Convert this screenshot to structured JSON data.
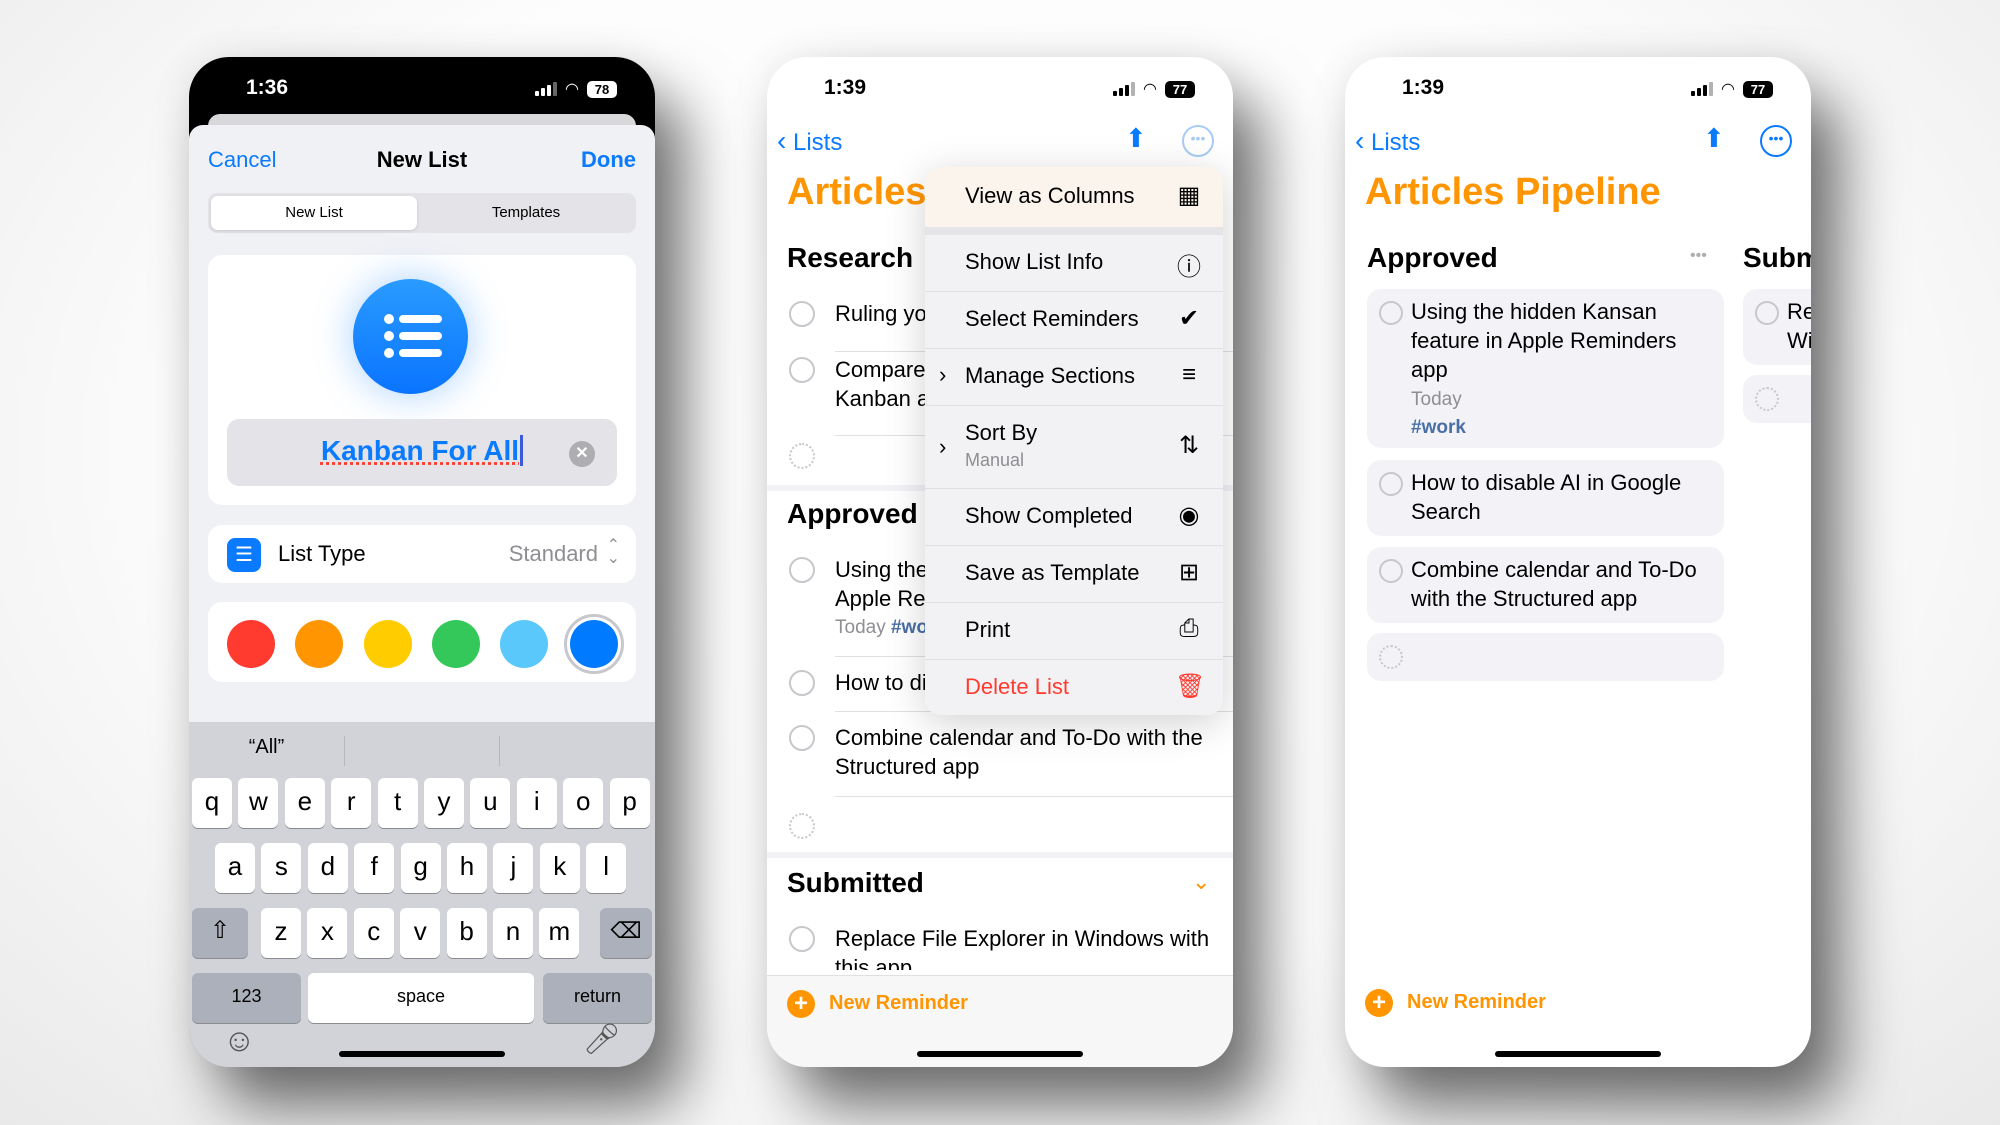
{
  "phones": [
    {
      "status": {
        "time": "1:36",
        "battery": "78"
      },
      "nav": {
        "cancel": "Cancel",
        "title": "New List",
        "done": "Done"
      },
      "segmented": {
        "options": [
          "New List",
          "Templates"
        ],
        "selected": "New List"
      },
      "icon": "list-bullet-icon",
      "name_field": {
        "value": "Kanban For All",
        "clear_icon": "clear-icon"
      },
      "list_type": {
        "label": "List Type",
        "value": "Standard",
        "icon": "list-bullet-icon"
      },
      "colors": [
        "#ff3b30",
        "#ff9500",
        "#ffcc00",
        "#34c759",
        "#5ac8fa",
        "#007aff"
      ],
      "selected_color": "#007aff",
      "keyboard": {
        "suggestions": [
          "“All”",
          "",
          ""
        ],
        "row1": [
          "q",
          "w",
          "e",
          "r",
          "t",
          "y",
          "u",
          "i",
          "o",
          "p"
        ],
        "row2": [
          "a",
          "s",
          "d",
          "f",
          "g",
          "h",
          "j",
          "k",
          "l"
        ],
        "row3": [
          "z",
          "x",
          "c",
          "v",
          "b",
          "n",
          "m"
        ],
        "numbers": "123",
        "space": "space",
        "return": "return"
      }
    },
    {
      "status": {
        "time": "1:39",
        "battery": "77"
      },
      "back": "Lists",
      "title": "Articles",
      "sections": [
        {
          "name": "Research",
          "items": [
            {
              "text": "Ruling yo"
            },
            {
              "text": "Compare",
              "text2": "Kanban a"
            }
          ]
        },
        {
          "name": "Approved",
          "items": [
            {
              "text": "Using the",
              "text2": "Apple Re",
              "meta_date": "Today",
              "meta_tag": "#wo"
            },
            {
              "text": "How to di"
            },
            {
              "text": "Combine calendar and To-Do with the",
              "text2": "Structured app"
            }
          ]
        },
        {
          "name": "Submitted",
          "items": [
            {
              "text": "Replace File Explorer in Windows with",
              "text2": "this app"
            }
          ]
        }
      ],
      "menu": [
        {
          "label": "View as Columns",
          "icon": "columns-icon"
        },
        {
          "label": "Show List Info",
          "icon": "info-icon"
        },
        {
          "label": "Select Reminders",
          "icon": "checkmark-circle-icon"
        },
        {
          "label": "Manage Sections",
          "icon": "sections-icon",
          "submenu": true
        },
        {
          "label": "Sort By",
          "sublabel": "Manual",
          "icon": "sort-icon",
          "submenu": true
        },
        {
          "label": "Show Completed",
          "icon": "eye-icon"
        },
        {
          "label": "Save as Template",
          "icon": "template-icon"
        },
        {
          "label": "Print",
          "icon": "printer-icon"
        },
        {
          "label": "Delete List",
          "icon": "trash-icon",
          "destructive": true
        }
      ],
      "new_reminder": "New Reminder"
    },
    {
      "status": {
        "time": "1:39",
        "battery": "77"
      },
      "back": "Lists",
      "title": "Articles Pipeline",
      "columns": [
        {
          "name": "Approved",
          "cards": [
            {
              "lines": [
                "Using the hidden Kansan",
                "feature in Apple Reminders",
                "app"
              ],
              "date": "Today",
              "tag": "#work"
            },
            {
              "lines": [
                "How to disable AI in Google",
                "Search"
              ]
            },
            {
              "lines": [
                "Combine calendar and To-Do",
                "with the Structured app"
              ]
            }
          ]
        },
        {
          "name": "Subm",
          "cards": [
            {
              "lines": [
                "Re",
                "Wi"
              ]
            }
          ]
        }
      ],
      "new_reminder": "New Reminder"
    }
  ],
  "colors": {
    "accent_blue": "#0a7aff",
    "accent_orange": "#ff9500",
    "destructive": "#ff3b30",
    "tag_blue": "#4a6fa5"
  }
}
